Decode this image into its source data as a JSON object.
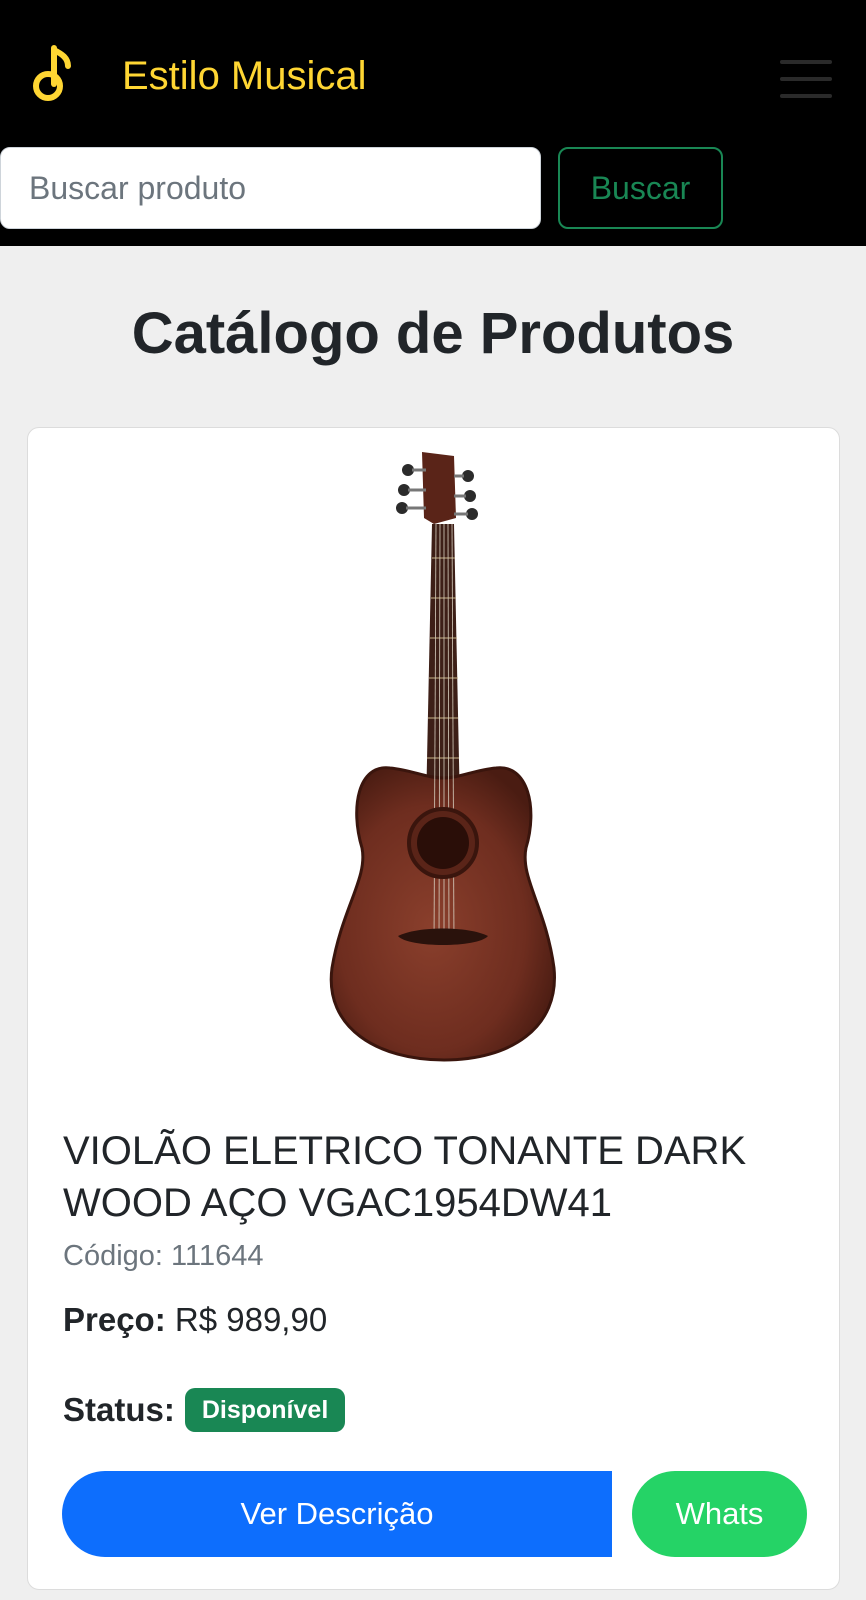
{
  "header": {
    "brand_name": "Estilo Musical",
    "logo_icon": "music-note-icon",
    "menu_icon": "hamburger-menu-icon",
    "accent_color": "#ffd633"
  },
  "search": {
    "placeholder": "Buscar produto",
    "value": "",
    "button_label": "Buscar"
  },
  "catalog": {
    "title": "Catálogo de Produtos",
    "products": [
      {
        "image_icon": "acoustic-guitar-image",
        "name": "VIOLÃO ELETRICO TONANTE DARK WOOD AÇO VGAC1954DW41",
        "code_label": "Código:",
        "code": "111644",
        "price_label": "Preço:",
        "price": "R$ 989,90",
        "status_label": "Status:",
        "status": "Disponível",
        "status_color": "#198754",
        "description_button": "Ver Descrição",
        "whatsapp_button": "Whats"
      }
    ]
  }
}
